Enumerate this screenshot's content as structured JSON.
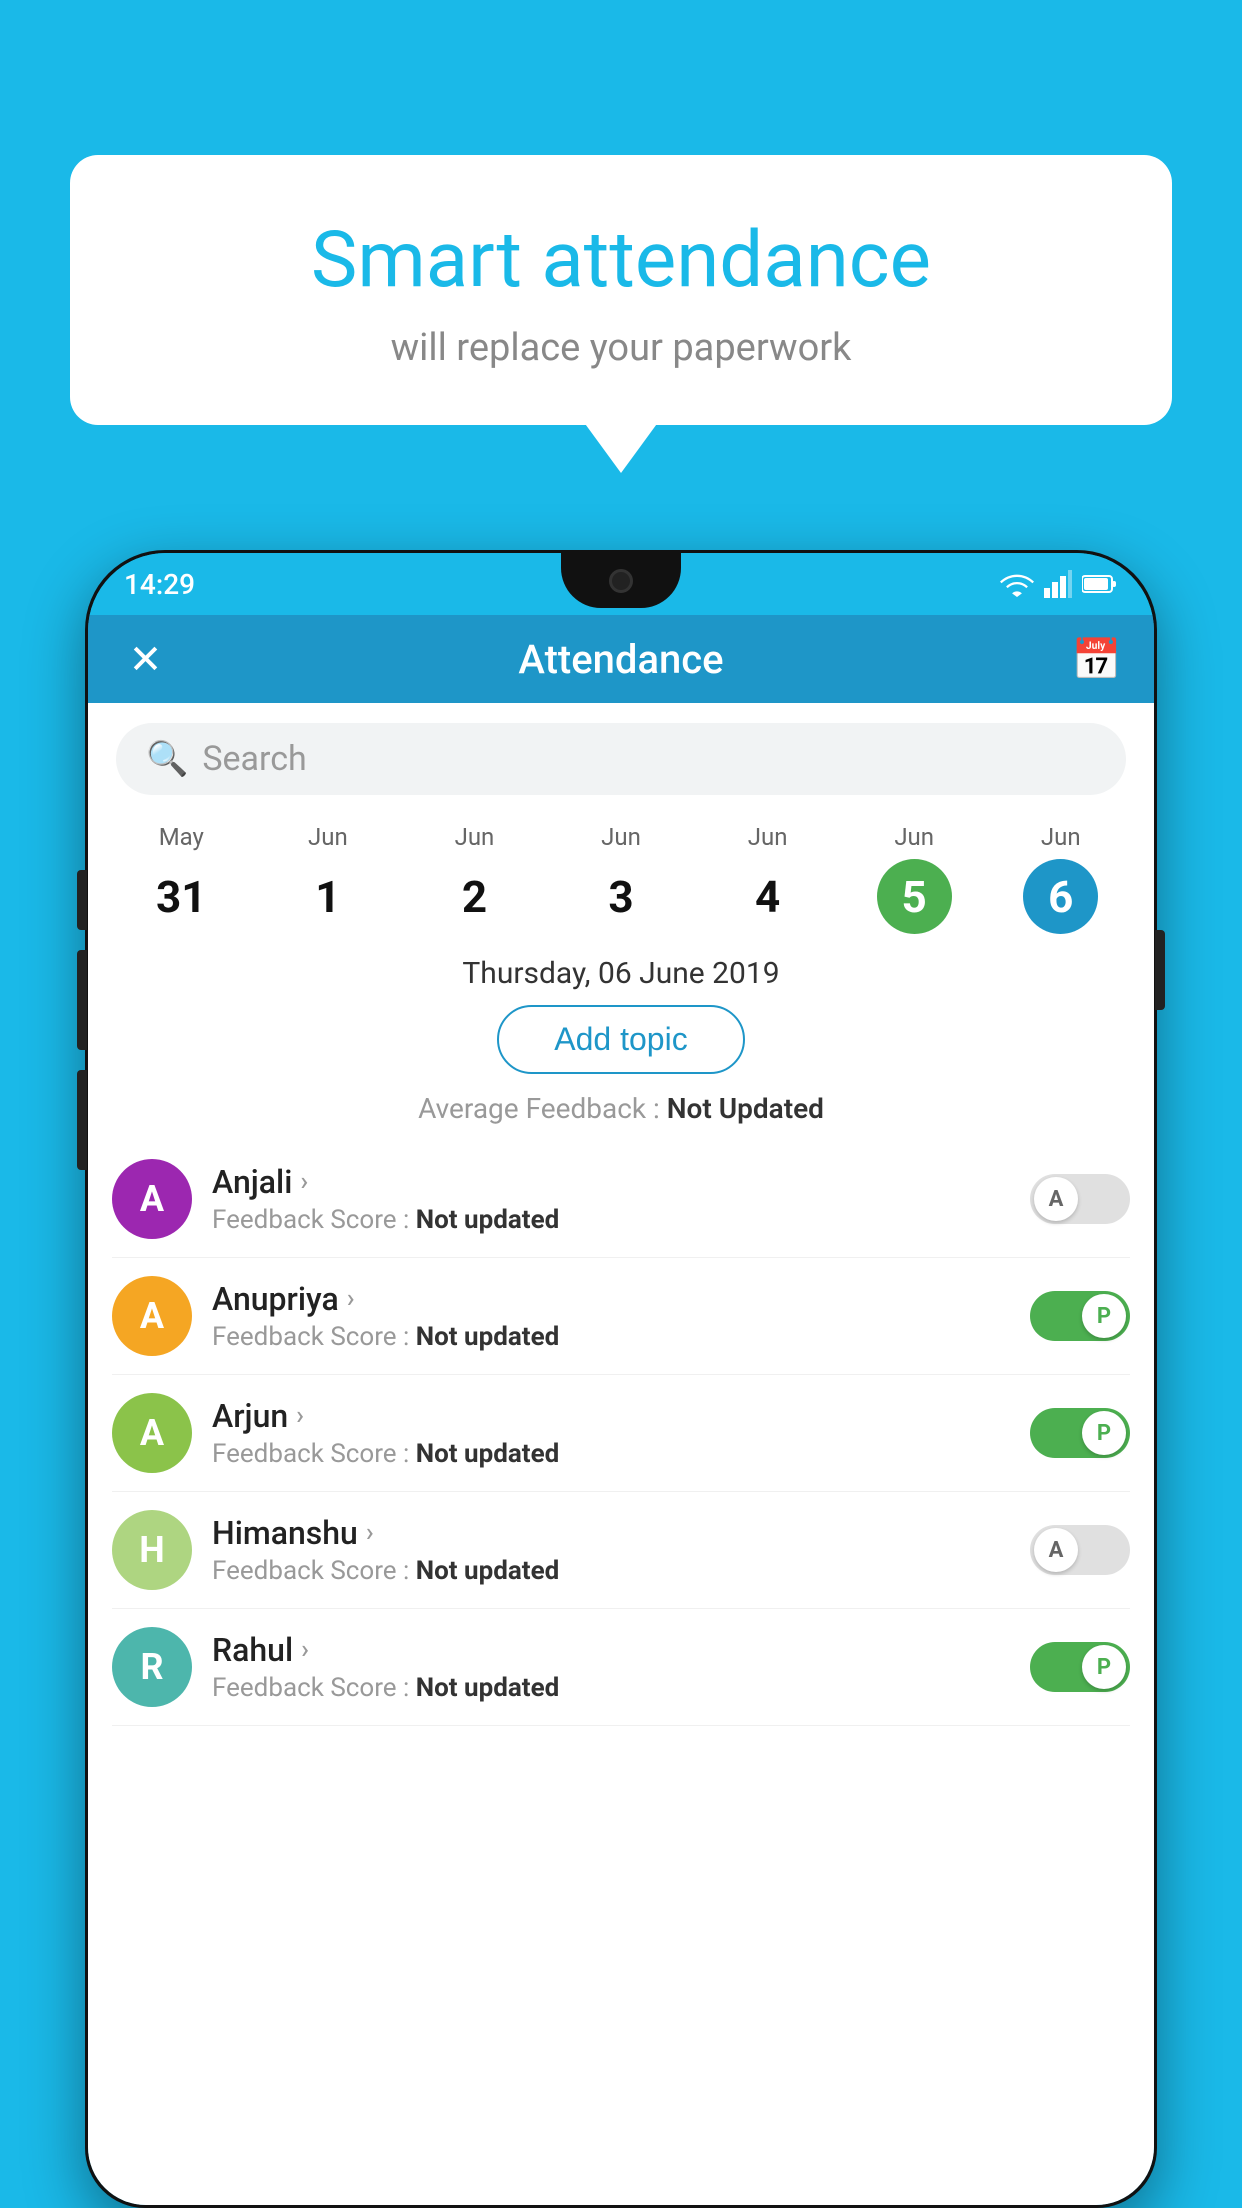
{
  "background_color": "#1ab9e8",
  "bubble": {
    "title": "Smart attendance",
    "subtitle": "will replace your paperwork"
  },
  "status_bar": {
    "time": "14:29",
    "wifi_icon": "wifi",
    "signal_icon": "signal",
    "battery_icon": "battery"
  },
  "app_bar": {
    "close_icon": "✕",
    "title": "Attendance",
    "calendar_icon": "📅"
  },
  "search": {
    "placeholder": "Search"
  },
  "calendar": {
    "dates": [
      {
        "month": "May",
        "day": "31",
        "state": "normal"
      },
      {
        "month": "Jun",
        "day": "1",
        "state": "normal"
      },
      {
        "month": "Jun",
        "day": "2",
        "state": "normal"
      },
      {
        "month": "Jun",
        "day": "3",
        "state": "normal"
      },
      {
        "month": "Jun",
        "day": "4",
        "state": "normal"
      },
      {
        "month": "Jun",
        "day": "5",
        "state": "today"
      },
      {
        "month": "Jun",
        "day": "6",
        "state": "selected"
      }
    ]
  },
  "selected_date": "Thursday, 06 June 2019",
  "add_topic_label": "Add topic",
  "avg_feedback_label": "Average Feedback :",
  "avg_feedback_value": "Not Updated",
  "students": [
    {
      "name": "Anjali",
      "avatar_letter": "A",
      "avatar_color": "#9c27b0",
      "feedback_label": "Feedback Score :",
      "feedback_value": "Not updated",
      "toggle_state": "off",
      "toggle_letter": "A"
    },
    {
      "name": "Anupriya",
      "avatar_letter": "A",
      "avatar_color": "#f5a623",
      "feedback_label": "Feedback Score :",
      "feedback_value": "Not updated",
      "toggle_state": "on",
      "toggle_letter": "P"
    },
    {
      "name": "Arjun",
      "avatar_letter": "A",
      "avatar_color": "#8bc34a",
      "feedback_label": "Feedback Score :",
      "feedback_value": "Not updated",
      "toggle_state": "on",
      "toggle_letter": "P"
    },
    {
      "name": "Himanshu",
      "avatar_letter": "H",
      "avatar_color": "#aed581",
      "feedback_label": "Feedback Score :",
      "feedback_value": "Not updated",
      "toggle_state": "off",
      "toggle_letter": "A"
    },
    {
      "name": "Rahul",
      "avatar_letter": "R",
      "avatar_color": "#4db6ac",
      "feedback_label": "Feedback Score :",
      "feedback_value": "Not updated",
      "toggle_state": "on",
      "toggle_letter": "P"
    }
  ]
}
